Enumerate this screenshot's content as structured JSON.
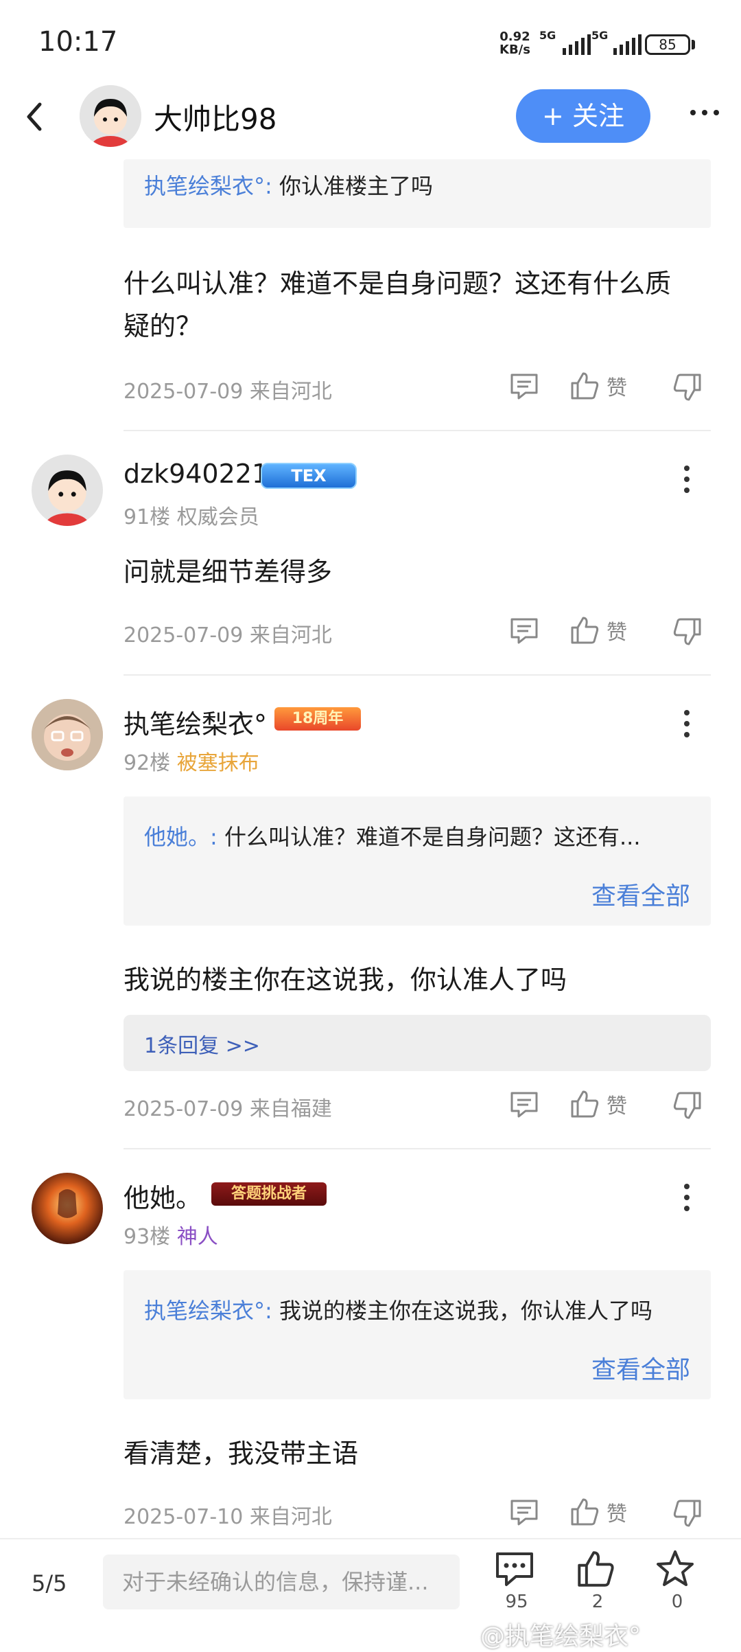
{
  "status_bar": {
    "time": "10:17",
    "net_speed_value": "0.92",
    "net_speed_unit": "KB/s",
    "sim1": "5G",
    "sim2": "5G",
    "battery": "85"
  },
  "header": {
    "name": "大帅比98",
    "follow_label": "+ 关注"
  },
  "top_quote": {
    "author": "执笔绘梨衣°:",
    "text": "你认准楼主了吗"
  },
  "top_post": {
    "text_line1": "什么叫认准？难道不是自身问题？这还有什么质",
    "text_line2": "疑的？",
    "meta": "2025-07-09 来自河北"
  },
  "like_label": "赞",
  "posts": [
    {
      "username": "dzk940221",
      "badge": "TEX",
      "floor": "91楼",
      "title": "权威会员",
      "title_color": "#9a9a9a",
      "text": "问就是细节差得多",
      "meta": "2025-07-09 来自河北"
    },
    {
      "username": "执笔绘梨衣°",
      "badge": "18周年",
      "floor": "92楼",
      "title": "被塞抹布",
      "title_color": "#e8a53a",
      "quote_author": "他她。:",
      "quote_text": "什么叫认准？难道不是自身问题？这还有...",
      "view_all": "查看全部",
      "text": "我说的楼主你在这说我，你认准人了吗",
      "replies": "1条回复 >>",
      "meta": "2025-07-09 来自福建"
    },
    {
      "username": "他她。",
      "badge": "答题挑战者",
      "floor": "93楼",
      "title": "神人",
      "title_color": "#8a4fc4",
      "quote_author": "执笔绘梨衣°:",
      "quote_text": "我说的楼主你在这说我，你认准人了吗",
      "view_all": "查看全部",
      "text": "看清楚，我没带主语",
      "meta": "2025-07-10 来自河北"
    }
  ],
  "bottom_bar": {
    "pager": "5/5",
    "input_placeholder": "对于未经确认的信息，保持谨...",
    "comments_count": "95",
    "likes_count": "2",
    "favorites_count": "0"
  },
  "watermark": "@执笔绘梨衣°",
  "colors": {
    "accent": "#4e8ef7",
    "link": "#4a7fd8"
  },
  "icons": [
    "back-arrow-icon",
    "more-icon",
    "comment-icon",
    "thumbs-up-icon",
    "thumbs-down-icon",
    "star-icon"
  ]
}
